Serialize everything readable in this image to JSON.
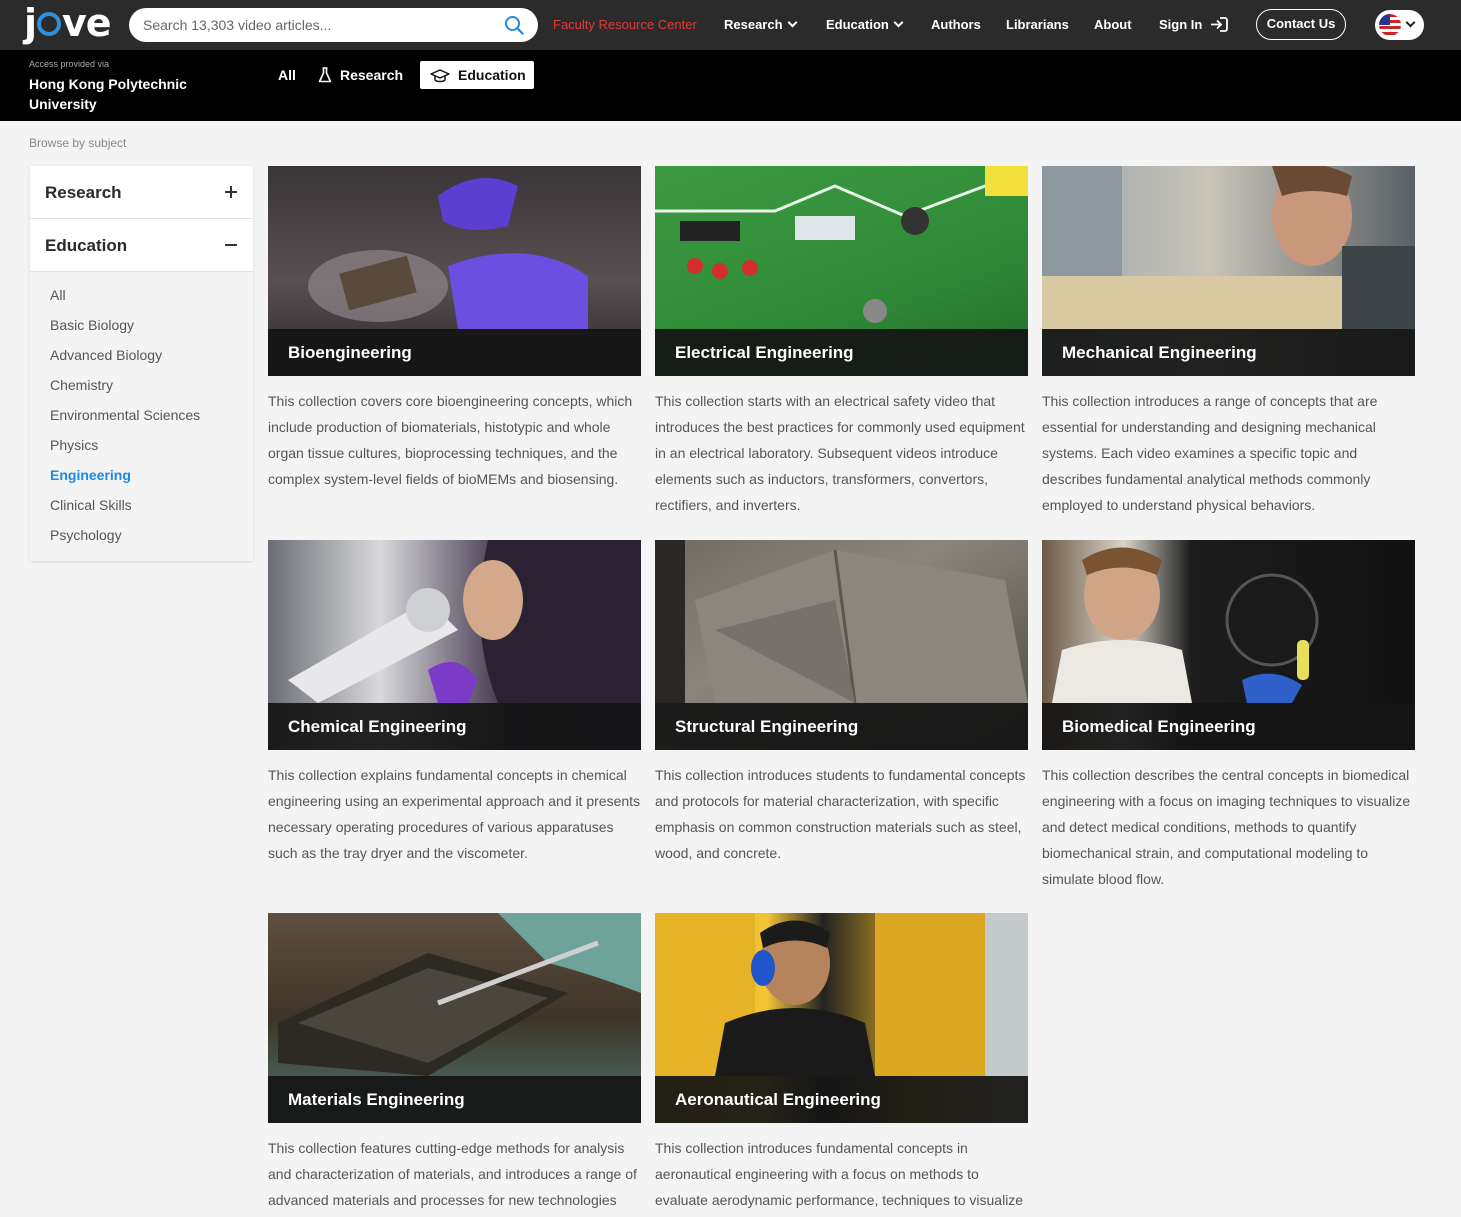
{
  "header": {
    "logo_text": "jove",
    "search_placeholder": "Search 13,303 video articles...",
    "nav": {
      "faculty": "Faculty Resource Center",
      "research": "Research",
      "education": "Education",
      "authors": "Authors",
      "librarians": "Librarians",
      "about": "About",
      "signin": "Sign In",
      "contact": "Contact Us"
    },
    "language_icon": "us-flag-icon"
  },
  "subbar": {
    "access_label": "Access provided via",
    "institution": "Hong Kong Polytechnic University",
    "tabs": {
      "all": "All",
      "research": "Research",
      "education": "Education"
    }
  },
  "browse_label": "Browse by subject",
  "sidebar": {
    "research": "Research",
    "education": "Education",
    "items": [
      "All",
      "Basic Biology",
      "Advanced Biology",
      "Chemistry",
      "Environmental Sciences",
      "Physics",
      "Engineering",
      "Clinical Skills",
      "Psychology"
    ],
    "active_item": "Engineering"
  },
  "cards": [
    {
      "title": "Bioengineering",
      "desc": "This collection covers core bioengineering concepts, which include production of biomaterials, histotypic and whole organ tissue cultures, bioprocessing techniques, and the complex system-level fields of bioMEMs and biosensing."
    },
    {
      "title": "Electrical Engineering",
      "desc": "This collection starts with an electrical safety video that introduces the best practices for commonly used equipment in an electrical laboratory. Subsequent videos introduce elements such as inductors, transformers, convertors, rectifiers, and inverters."
    },
    {
      "title": "Mechanical Engineering",
      "desc": "This collection introduces a range of concepts that are essential for understanding and designing mechanical systems. Each video examines a specific topic and describes fundamental analytical methods commonly employed to understand physical behaviors."
    },
    {
      "title": "Chemical Engineering",
      "desc": "This collection explains fundamental concepts in chemical engineering using an experimental approach and it presents necessary operating procedures of various apparatuses such as the tray dryer and the viscometer."
    },
    {
      "title": "Structural Engineering",
      "desc": "This collection introduces students to fundamental concepts and protocols for material characterization, with specific emphasis on common construction materials such as steel, wood, and concrete."
    },
    {
      "title": "Biomedical Engineering",
      "desc": "This collection describes the central concepts in biomedical engineering with a focus on imaging techniques to visualize and detect medical conditions, methods to quantify biomechanical strain, and computational modeling to simulate blood flow."
    },
    {
      "title": "Materials Engineering",
      "desc": "This collection features cutting-edge methods for analysis and characterization of materials, and introduces a range of advanced materials and processes for new technologies"
    },
    {
      "title": "Aeronautical Engineering",
      "desc": "This collection introduces fundamental concepts in aeronautical engineering with a focus on methods to evaluate aerodynamic performance, techniques to visualize"
    }
  ],
  "colors": {
    "accent_red": "#e53935",
    "accent_blue": "#1e88e5",
    "nav_bg": "#2b2b2b",
    "subbar_bg": "#000000"
  }
}
